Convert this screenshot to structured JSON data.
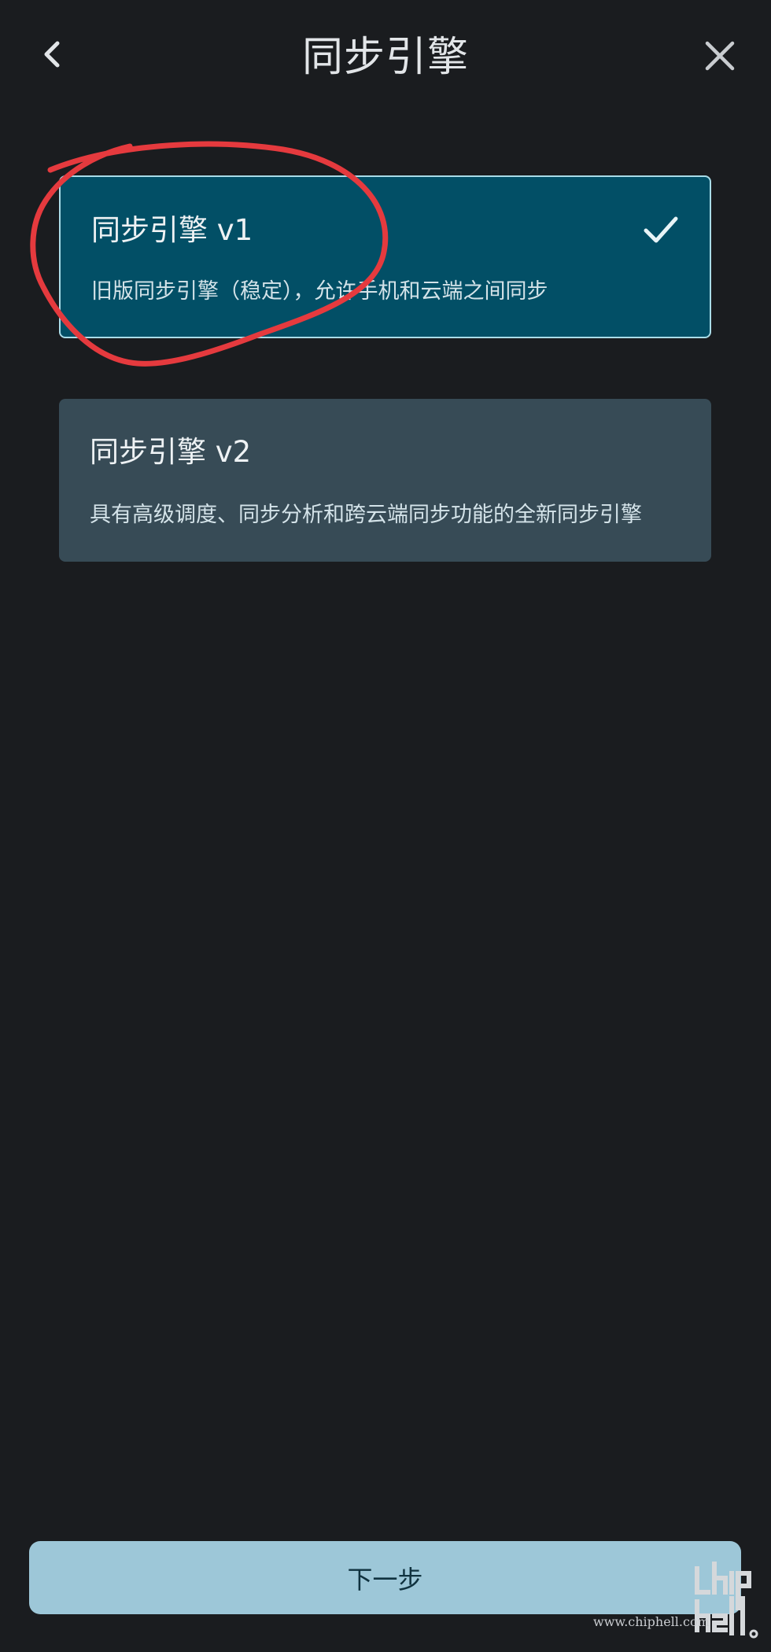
{
  "header": {
    "title": "同步引擎",
    "back_icon": "chevron-left-icon",
    "close_icon": "close-icon"
  },
  "options": [
    {
      "title": "同步引擎 v1",
      "description": "旧版同步引擎（稳定），允许手机和云端之间同步",
      "selected": true,
      "selected_icon": "check-icon"
    },
    {
      "title": "同步引擎 v2",
      "description": "具有高级调度、同步分析和跨云端同步功能的全新同步引擎",
      "selected": false
    }
  ],
  "footer": {
    "next_label": "下一步"
  },
  "watermark": {
    "site": "www.chiphell.com",
    "logo": "chiphell"
  },
  "colors": {
    "background": "#1a1c1f",
    "selected_card": "#024f66",
    "selected_border": "#a9dce8",
    "unselected_card": "#374b56",
    "next_button": "#9dc7d8",
    "annotation_circle": "#e53a3e"
  }
}
